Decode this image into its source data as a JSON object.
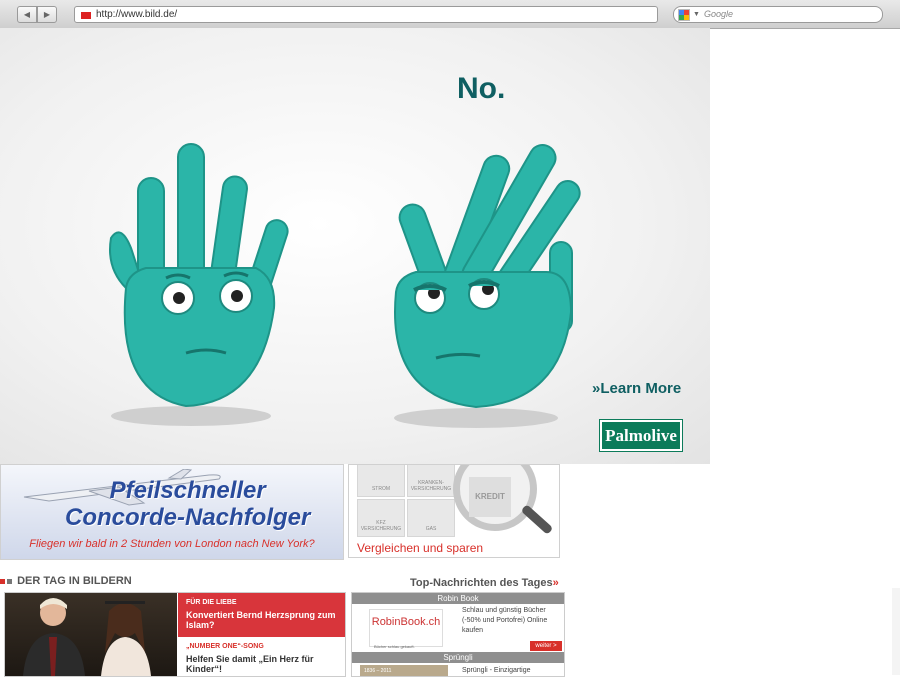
{
  "browser": {
    "url": "http://www.bild.de/",
    "search_placeholder": "Google"
  },
  "ad": {
    "headline": "No.",
    "cta": "»Learn More",
    "brand": "Palmolive",
    "colors": {
      "teal": "#2bb5a8",
      "text": "#0f5f62",
      "logo": "#0c7b5a"
    }
  },
  "promo": {
    "title_line1": "Pfeilschneller",
    "title_line2": "Concorde-Nachfolger",
    "subtitle": "Fliegen wir bald in 2 Stunden von London nach New York?"
  },
  "compare": {
    "tiles": [
      "STROM",
      "KRANKEN-VERSICHERUNG",
      "KFZ VERSICHERUNG",
      "GAS"
    ],
    "kredit": "KREDIT",
    "link": "Vergleichen und sparen"
  },
  "section": {
    "title": "DER TAG IN BILDERN",
    "top_news": "Top-Nachrichten des Tages",
    "top_news_arrow": "»"
  },
  "gallery": {
    "items": [
      {
        "kicker": "FÜR DIE LIEBE",
        "headline": "Konvertiert Bernd Herzsprung zum Islam?"
      },
      {
        "kicker": "„NUMBER ONE“-SONG",
        "headline": "Helfen Sie damit „Ein Herz für Kinder“!"
      }
    ]
  },
  "sidebar": {
    "robin": {
      "header": "Robin Book",
      "logo": "RobinBook.ch",
      "logo_tag": "Bücher schlau gekauft.",
      "text": "Schlau und günstig Bücher (-50% und Portofrei) Online kaufen",
      "button": "weiter >"
    },
    "spruengli": {
      "header": "Sprüngli",
      "img_text": "1836 – 2011",
      "text": "Sprüngli - Einzigartige"
    }
  }
}
